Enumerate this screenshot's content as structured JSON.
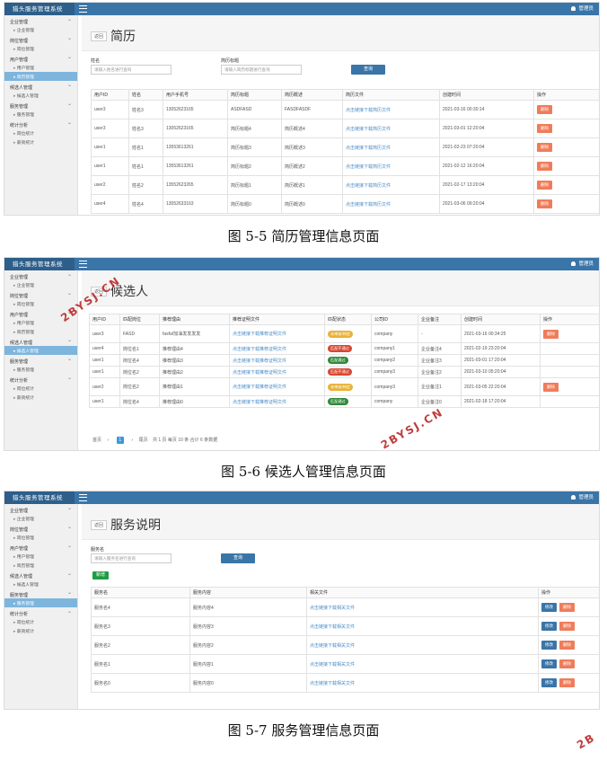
{
  "app": {
    "brand": "猎头服务管理系统",
    "user": "管理员"
  },
  "sidebar": {
    "groups": [
      {
        "label": "企业管理",
        "items": [
          "企业管理"
        ]
      },
      {
        "label": "岗位管理",
        "items": [
          "岗位管理"
        ]
      },
      {
        "label": "用户管理",
        "items": [
          "用户管理",
          "简历管理"
        ]
      },
      {
        "label": "候选人管理",
        "items": [
          "候选人管理"
        ]
      },
      {
        "label": "服务管理",
        "items": [
          "服务管理"
        ]
      },
      {
        "label": "统计分析",
        "items": [
          "岗位统计",
          "薪资统计"
        ]
      }
    ]
  },
  "back_label": "返回",
  "fig1": {
    "title": "简历",
    "caption": "图 5-5 简历管理信息页面",
    "filters": {
      "name_label": "姓名",
      "name_placeholder": "请输入姓名进行查询",
      "title_label": "简历标题",
      "title_placeholder": "请输入简历标题进行查询",
      "query": "查询"
    },
    "headers": [
      "用户ID",
      "姓名",
      "用户手机号",
      "简历标题",
      "简历概述",
      "简历文件",
      "创建时间",
      "操作"
    ],
    "rows": [
      [
        "user3",
        "姓名3",
        "13052623165",
        "ASDFASD",
        "FASDFASDF",
        "点击链接下载简历文件",
        "2021-03-16 00:30:14",
        "删除"
      ],
      [
        "user3",
        "姓名3",
        "13052623165",
        "简历标题4",
        "简历概述4",
        "点击链接下载简历文件",
        "2021-03-01 12:20:04",
        "删除"
      ],
      [
        "user1",
        "姓名1",
        "13553613261",
        "简历标题3",
        "简历概述3",
        "点击链接下载简历文件",
        "2021-02-23 07:20:04",
        "删除"
      ],
      [
        "user1",
        "姓名1",
        "13553613261",
        "简历标题2",
        "简历概述2",
        "点击链接下载简历文件",
        "2021-02-12 16:20:04",
        "删除"
      ],
      [
        "user2",
        "姓名2",
        "13552623265",
        "简历标题1",
        "简历概述1",
        "点击链接下载简历文件",
        "2021-02-17 13:20:04",
        "删除"
      ],
      [
        "user4",
        "姓名4",
        "13052633163",
        "简历标题0",
        "简历概述0",
        "点击链接下载简历文件",
        "2021-03-06 09:20:04",
        "删除"
      ]
    ]
  },
  "fig2": {
    "title": "候选人",
    "caption": "图 5-6 候选人管理信息页面",
    "headers": [
      "用户ID",
      "匹配岗位",
      "推荐理由",
      "推荐证明文件",
      "匹配状态",
      "公司ID",
      "企业备注",
      "创建时间",
      "操作"
    ],
    "rows": [
      [
        "user3",
        "FASD",
        "fasfaf加油发发发发",
        "点击链接下载推荐证明文件",
        "未审核/待定",
        "yellow",
        "company",
        "-",
        "2021-03-16 00:34:25",
        "删除"
      ],
      [
        "user4",
        "岗位名1",
        "推荐理由4",
        "点击链接下载推荐证明文件",
        "匹配不通过",
        "red",
        "company1",
        "企业备注4",
        "2021-02-19 23:20:04",
        ""
      ],
      [
        "user1",
        "岗位名4",
        "推荐理由3",
        "点击链接下载推荐证明文件",
        "匹配通过",
        "green",
        "company2",
        "企业备注3",
        "2021-03-01 17:20:04",
        ""
      ],
      [
        "user1",
        "岗位名2",
        "推荐理由2",
        "点击链接下载推荐证明文件",
        "匹配不通过",
        "red",
        "company3",
        "企业备注2",
        "2021-03-10 05:20:04",
        ""
      ],
      [
        "user2",
        "岗位名2",
        "推荐理由1",
        "点击链接下载推荐证明文件",
        "未审核/待定",
        "yellow",
        "company3",
        "企业备注1",
        "2021-03-05 22:20:04",
        "删除"
      ],
      [
        "user1",
        "岗位名4",
        "推荐理由0",
        "点击链接下载推荐证明文件",
        "匹配通过",
        "green",
        "company",
        "企业备注0",
        "2021-02-18 17:20:04",
        ""
      ]
    ],
    "pager": {
      "first": "首页",
      "prev": "‹",
      "current": "1",
      "next": "›",
      "last": "尾页",
      "info": "共 1 页  每页 10 条  合计 6 条数据"
    }
  },
  "fig3": {
    "title": "服务说明",
    "caption": "图 5-7 服务管理信息页面",
    "filters": {
      "name_label": "服务名",
      "name_placeholder": "请输入服务名进行查询",
      "query": "查询",
      "add": "新增"
    },
    "headers": [
      "服务名",
      "服务内容",
      "相关文件",
      "操作"
    ],
    "rows": [
      [
        "服务名4",
        "服务内容4",
        "点击链接下载相关文件"
      ],
      [
        "服务名3",
        "服务内容3",
        "点击链接下载相关文件"
      ],
      [
        "服务名2",
        "服务内容2",
        "点击链接下载相关文件"
      ],
      [
        "服务名1",
        "服务内容1",
        "点击链接下载相关文件"
      ],
      [
        "服务名0",
        "服务内容0",
        "点击链接下载相关文件"
      ]
    ],
    "edit": "修改",
    "delete": "删除"
  },
  "watermark": "2BYSJ.CN",
  "colors": {
    "topbar": "#3a75a8",
    "active_menu": "#7eb5dd",
    "delete_button": "#f07c5a",
    "add_button": "#1f9d44"
  }
}
